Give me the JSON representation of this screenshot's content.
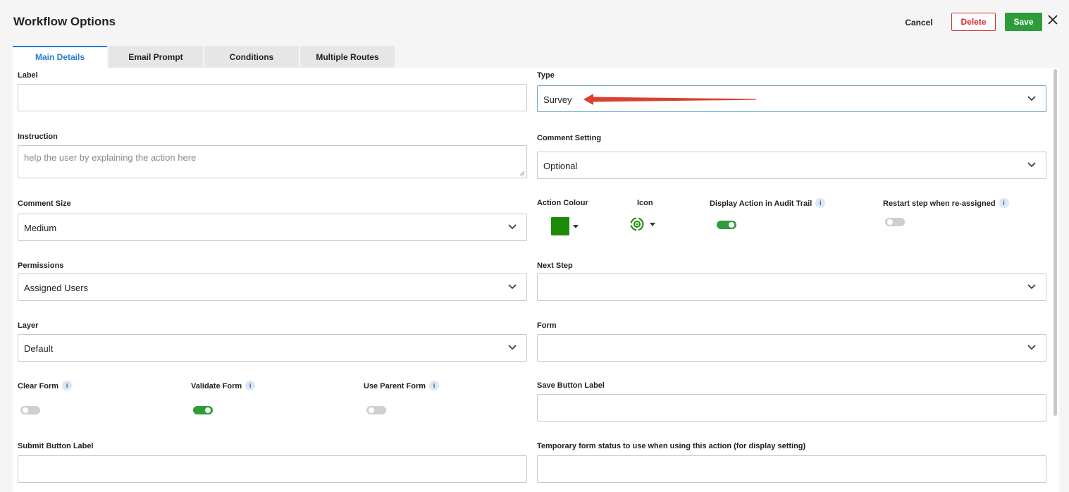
{
  "header": {
    "title": "Workflow Options",
    "cancel_label": "Cancel",
    "delete_label": "Delete",
    "save_label": "Save"
  },
  "tabs": [
    {
      "label": "Main Details",
      "active": true
    },
    {
      "label": "Email Prompt",
      "active": false
    },
    {
      "label": "Conditions",
      "active": false
    },
    {
      "label": "Multiple Routes",
      "active": false
    }
  ],
  "form": {
    "label": {
      "label": "Label",
      "value": ""
    },
    "type": {
      "label": "Type",
      "value": "Survey"
    },
    "instruction": {
      "label": "Instruction",
      "placeholder": "help the user by explaining the action here",
      "value": ""
    },
    "comment_setting": {
      "label": "Comment Setting",
      "value": "Optional"
    },
    "comment_size": {
      "label": "Comment Size",
      "value": "Medium"
    },
    "action_colour": {
      "label": "Action Colour",
      "color": "#1f8a0a"
    },
    "icon": {
      "label": "Icon",
      "icon": "gear-cycle-icon"
    },
    "display_audit": {
      "label": "Display Action in Audit Trail",
      "on": true
    },
    "restart_step": {
      "label": "Restart step when re-assigned",
      "on": false
    },
    "permissions": {
      "label": "Permissions",
      "value": "Assigned Users"
    },
    "next_step": {
      "label": "Next Step",
      "value": ""
    },
    "layer": {
      "label": "Layer",
      "value": "Default"
    },
    "form_select": {
      "label": "Form",
      "value": ""
    },
    "clear_form": {
      "label": "Clear Form",
      "on": false
    },
    "validate_form": {
      "label": "Validate Form",
      "on": true
    },
    "use_parent_form": {
      "label": "Use Parent Form",
      "on": false
    },
    "save_button_label": {
      "label": "Save Button Label",
      "value": ""
    },
    "submit_button_label": {
      "label": "Submit Button Label",
      "value": ""
    },
    "temp_status": {
      "label": "Temporary form status to use when using this action (for display setting)",
      "value": ""
    }
  },
  "info_glyph": "i",
  "colors": {
    "accent": "#2a7bd3",
    "save": "#2e9c3b",
    "delete": "#d32f2f",
    "annotation_arrow": "#d9412e"
  }
}
